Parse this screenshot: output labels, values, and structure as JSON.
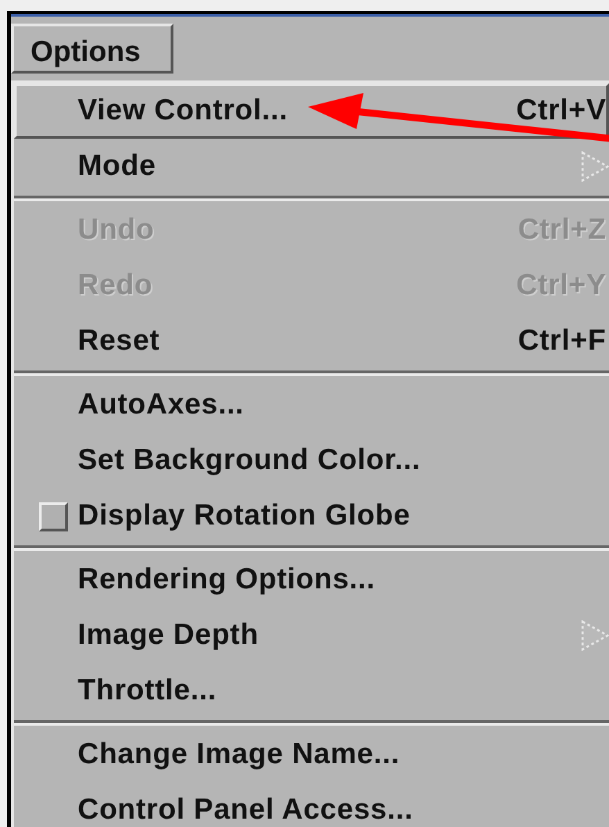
{
  "menubar": [
    {
      "label": "Options",
      "selected": true
    }
  ],
  "menu": {
    "groups": [
      {
        "items": [
          {
            "kind": "command",
            "label": "View Control...",
            "shortcut": "Ctrl+V",
            "disabled": false,
            "selected": true
          },
          {
            "kind": "cascade",
            "label": "Mode",
            "disabled": false,
            "selected": false
          }
        ]
      },
      {
        "items": [
          {
            "kind": "command",
            "label": "Undo",
            "shortcut": "Ctrl+Z",
            "disabled": true,
            "selected": false
          },
          {
            "kind": "command",
            "label": "Redo",
            "shortcut": "Ctrl+Y",
            "disabled": true,
            "selected": false
          },
          {
            "kind": "command",
            "label": "Reset",
            "shortcut": "Ctrl+F",
            "disabled": false,
            "selected": false
          }
        ]
      },
      {
        "items": [
          {
            "kind": "command",
            "label": "AutoAxes...",
            "disabled": false,
            "selected": false
          },
          {
            "kind": "command",
            "label": "Set Background Color...",
            "disabled": false,
            "selected": false
          },
          {
            "kind": "toggle",
            "label": "Display Rotation Globe",
            "checked": false,
            "disabled": false,
            "selected": false
          }
        ]
      },
      {
        "items": [
          {
            "kind": "command",
            "label": "Rendering Options...",
            "disabled": false,
            "selected": false
          },
          {
            "kind": "cascade",
            "label": "Image Depth",
            "disabled": false,
            "selected": false
          },
          {
            "kind": "command",
            "label": "Throttle...",
            "disabled": false,
            "selected": false
          }
        ]
      },
      {
        "items": [
          {
            "kind": "command",
            "label": "Change Image Name...",
            "disabled": false,
            "selected": false
          },
          {
            "kind": "command",
            "label": "Control Panel Access...",
            "disabled": false,
            "selected": false
          }
        ]
      }
    ]
  }
}
